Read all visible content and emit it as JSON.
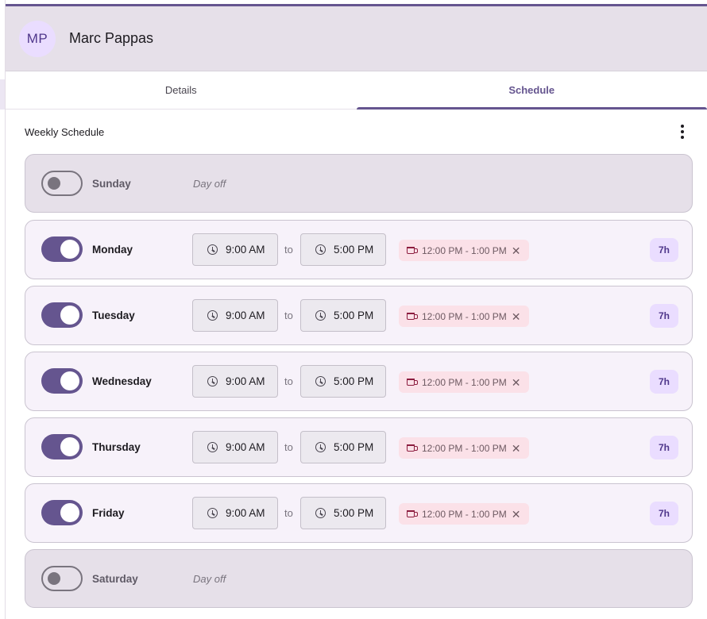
{
  "user": {
    "initials": "MP",
    "name": "Marc Pappas"
  },
  "tabs": [
    {
      "label": "Details",
      "active": false
    },
    {
      "label": "Schedule",
      "active": true
    }
  ],
  "schedule": {
    "title": "Weekly Schedule",
    "to_label": "to",
    "days": [
      {
        "name": "Sunday",
        "enabled": false,
        "status": "Day off"
      },
      {
        "name": "Monday",
        "enabled": true,
        "start": "9:00 AM",
        "end": "5:00 PM",
        "break": "12:00 PM - 1:00 PM",
        "hours": "7h"
      },
      {
        "name": "Tuesday",
        "enabled": true,
        "start": "9:00 AM",
        "end": "5:00 PM",
        "break": "12:00 PM - 1:00 PM",
        "hours": "7h"
      },
      {
        "name": "Wednesday",
        "enabled": true,
        "start": "9:00 AM",
        "end": "5:00 PM",
        "break": "12:00 PM - 1:00 PM",
        "hours": "7h"
      },
      {
        "name": "Thursday",
        "enabled": true,
        "start": "9:00 AM",
        "end": "5:00 PM",
        "break": "12:00 PM - 1:00 PM",
        "hours": "7h"
      },
      {
        "name": "Friday",
        "enabled": true,
        "start": "9:00 AM",
        "end": "5:00 PM",
        "break": "12:00 PM - 1:00 PM",
        "hours": "7h"
      },
      {
        "name": "Saturday",
        "enabled": false,
        "status": "Day off"
      }
    ]
  },
  "icons": {
    "more": "more-vertical-icon",
    "time": "clock-icon",
    "break": "coffee-cup-icon",
    "remove": "close-icon"
  },
  "colors": {
    "primary": "#65558f",
    "header_bg": "#e6e0e9",
    "active_row_bg": "#f7f2fa",
    "break_chip_bg": "#fbe1e8",
    "hours_badge_bg": "#eaddff"
  }
}
